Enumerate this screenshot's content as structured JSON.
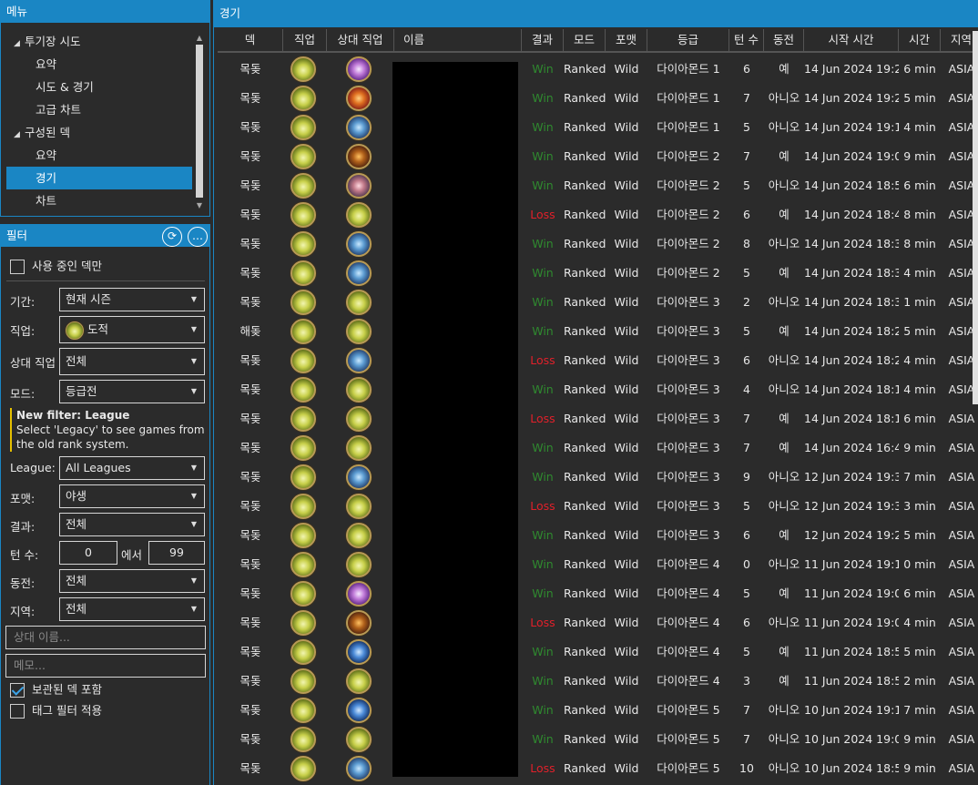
{
  "menu": {
    "title": "메뉴",
    "tree": [
      {
        "label": "투기장 시도",
        "level": 0,
        "expanded": true
      },
      {
        "label": "요약",
        "level": 1
      },
      {
        "label": "시도 & 경기",
        "level": 1
      },
      {
        "label": "고급 차트",
        "level": 1
      },
      {
        "label": "구성된 덱",
        "level": 0,
        "expanded": true
      },
      {
        "label": "요약",
        "level": 1
      },
      {
        "label": "경기",
        "level": 1,
        "selected": true
      },
      {
        "label": "차트",
        "level": 1
      }
    ]
  },
  "filter": {
    "title": "필터",
    "refresh_glyph": "⟳",
    "more_glyph": "…",
    "active_decks_only": {
      "label": "사용 중인 덱만",
      "checked": false
    },
    "period": {
      "label": "기간:",
      "value": "현재 시즌"
    },
    "class": {
      "label": "직업:",
      "value": "도적"
    },
    "opponent_class": {
      "label": "상대 직업",
      "value": "전체"
    },
    "mode": {
      "label": "모드:",
      "value": "등급전"
    },
    "notice": {
      "title": "New filter: League",
      "text": "Select 'Legacy' to see games from the old rank system."
    },
    "league": {
      "label": "League:",
      "value": "All Leagues"
    },
    "format": {
      "label": "포맷:",
      "value": "야생"
    },
    "result": {
      "label": "결과:",
      "value": "전체"
    },
    "turns": {
      "label": "턴 수:",
      "from": "0",
      "sep": "에서",
      "to": "99"
    },
    "coin": {
      "label": "동전:",
      "value": "전체"
    },
    "region": {
      "label": "지역:",
      "value": "전체"
    },
    "opponent_name": {
      "placeholder": "상대 이름..."
    },
    "note": {
      "placeholder": "메모..."
    },
    "include_archived": {
      "label": "보관된 덱 포함",
      "checked": true
    },
    "apply_tag_filter": {
      "label": "태그 필터 적용",
      "checked": false
    }
  },
  "games": {
    "title": "경기",
    "columns": [
      "덱",
      "직업",
      "상대 직업",
      "이름",
      "결과",
      "모드",
      "포맷",
      "등급",
      "턴 수",
      "동전",
      "시작 시간",
      "시간",
      "지역"
    ],
    "rows": [
      {
        "deck": "목돚",
        "class": "rogue",
        "opp": "priest",
        "result": "Win",
        "mode": "Ranked",
        "format": "Wild",
        "rank": "다이아몬드 1",
        "turns": "6",
        "coin": "예",
        "start": "14 Jun 2024 19:26",
        "duration": "6 min",
        "region": "ASIA"
      },
      {
        "deck": "목돚",
        "class": "rogue",
        "opp": "mage",
        "result": "Win",
        "mode": "Ranked",
        "format": "Wild",
        "rank": "다이아몬드 1",
        "turns": "7",
        "coin": "아니오",
        "start": "14 Jun 2024 19:20",
        "duration": "5 min",
        "region": "ASIA"
      },
      {
        "deck": "목돚",
        "class": "rogue",
        "opp": "warrior",
        "result": "Win",
        "mode": "Ranked",
        "format": "Wild",
        "rank": "다이아몬드 1",
        "turns": "5",
        "coin": "아니오",
        "start": "14 Jun 2024 19:13",
        "duration": "4 min",
        "region": "ASIA"
      },
      {
        "deck": "목돚",
        "class": "rogue",
        "opp": "druid",
        "result": "Win",
        "mode": "Ranked",
        "format": "Wild",
        "rank": "다이아몬드 2",
        "turns": "7",
        "coin": "예",
        "start": "14 Jun 2024 19:03",
        "duration": "9 min",
        "region": "ASIA"
      },
      {
        "deck": "목돚",
        "class": "rogue",
        "opp": "paladin",
        "result": "Win",
        "mode": "Ranked",
        "format": "Wild",
        "rank": "다이아몬드 2",
        "turns": "5",
        "coin": "아니오",
        "start": "14 Jun 2024 18:57",
        "duration": "6 min",
        "region": "ASIA"
      },
      {
        "deck": "목돚",
        "class": "rogue",
        "opp": "rogue",
        "result": "Loss",
        "mode": "Ranked",
        "format": "Wild",
        "rank": "다이아몬드 2",
        "turns": "6",
        "coin": "예",
        "start": "14 Jun 2024 18:47",
        "duration": "8 min",
        "region": "ASIA"
      },
      {
        "deck": "목돚",
        "class": "rogue",
        "opp": "warrior",
        "result": "Win",
        "mode": "Ranked",
        "format": "Wild",
        "rank": "다이아몬드 2",
        "turns": "8",
        "coin": "아니오",
        "start": "14 Jun 2024 18:39",
        "duration": "8 min",
        "region": "ASIA"
      },
      {
        "deck": "목돚",
        "class": "rogue",
        "opp": "warrior",
        "result": "Win",
        "mode": "Ranked",
        "format": "Wild",
        "rank": "다이아몬드 2",
        "turns": "5",
        "coin": "예",
        "start": "14 Jun 2024 18:34",
        "duration": "4 min",
        "region": "ASIA"
      },
      {
        "deck": "목돚",
        "class": "rogue",
        "opp": "rogue",
        "result": "Win",
        "mode": "Ranked",
        "format": "Wild",
        "rank": "다이아몬드 3",
        "turns": "2",
        "coin": "아니오",
        "start": "14 Jun 2024 18:32",
        "duration": "1 min",
        "region": "ASIA"
      },
      {
        "deck": "해돚",
        "class": "rogue",
        "opp": "rogue",
        "result": "Win",
        "mode": "Ranked",
        "format": "Wild",
        "rank": "다이아몬드 3",
        "turns": "5",
        "coin": "예",
        "start": "14 Jun 2024 18:27",
        "duration": "5 min",
        "region": "ASIA"
      },
      {
        "deck": "목돚",
        "class": "rogue",
        "opp": "warrior",
        "result": "Loss",
        "mode": "Ranked",
        "format": "Wild",
        "rank": "다이아몬드 3",
        "turns": "6",
        "coin": "아니오",
        "start": "14 Jun 2024 18:22",
        "duration": "4 min",
        "region": "ASIA"
      },
      {
        "deck": "목돚",
        "class": "rogue",
        "opp": "rogue",
        "result": "Win",
        "mode": "Ranked",
        "format": "Wild",
        "rank": "다이아몬드 3",
        "turns": "4",
        "coin": "아니오",
        "start": "14 Jun 2024 18:17",
        "duration": "4 min",
        "region": "ASIA"
      },
      {
        "deck": "목돚",
        "class": "rogue",
        "opp": "rogue",
        "result": "Loss",
        "mode": "Ranked",
        "format": "Wild",
        "rank": "다이아몬드 3",
        "turns": "7",
        "coin": "예",
        "start": "14 Jun 2024 18:11",
        "duration": "6 min",
        "region": "ASIA"
      },
      {
        "deck": "목돚",
        "class": "rogue",
        "opp": "rogue",
        "result": "Win",
        "mode": "Ranked",
        "format": "Wild",
        "rank": "다이아몬드 3",
        "turns": "7",
        "coin": "예",
        "start": "14 Jun 2024 16:47",
        "duration": "9 min",
        "region": "ASIA"
      },
      {
        "deck": "목돚",
        "class": "rogue",
        "opp": "warrior",
        "result": "Win",
        "mode": "Ranked",
        "format": "Wild",
        "rank": "다이아몬드 3",
        "turns": "9",
        "coin": "아니오",
        "start": "12 Jun 2024 19:35",
        "duration": "7 min",
        "region": "ASIA"
      },
      {
        "deck": "목돚",
        "class": "rogue",
        "opp": "rogue",
        "result": "Loss",
        "mode": "Ranked",
        "format": "Wild",
        "rank": "다이아몬드 3",
        "turns": "5",
        "coin": "아니오",
        "start": "12 Jun 2024 19:31",
        "duration": "3 min",
        "region": "ASIA"
      },
      {
        "deck": "목돚",
        "class": "rogue",
        "opp": "rogue",
        "result": "Win",
        "mode": "Ranked",
        "format": "Wild",
        "rank": "다이아몬드 3",
        "turns": "6",
        "coin": "예",
        "start": "12 Jun 2024 19:26",
        "duration": "5 min",
        "region": "ASIA"
      },
      {
        "deck": "목돚",
        "class": "rogue",
        "opp": "rogue",
        "result": "Win",
        "mode": "Ranked",
        "format": "Wild",
        "rank": "다이아몬드 4",
        "turns": "0",
        "coin": "아니오",
        "start": "11 Jun 2024 19:15",
        "duration": "0 min",
        "region": "ASIA"
      },
      {
        "deck": "목돚",
        "class": "rogue",
        "opp": "priest",
        "result": "Win",
        "mode": "Ranked",
        "format": "Wild",
        "rank": "다이아몬드 4",
        "turns": "5",
        "coin": "예",
        "start": "11 Jun 2024 19:09",
        "duration": "6 min",
        "region": "ASIA"
      },
      {
        "deck": "목돚",
        "class": "rogue",
        "opp": "druid",
        "result": "Loss",
        "mode": "Ranked",
        "format": "Wild",
        "rank": "다이아몬드 4",
        "turns": "6",
        "coin": "아니오",
        "start": "11 Jun 2024 19:04",
        "duration": "4 min",
        "region": "ASIA"
      },
      {
        "deck": "목돚",
        "class": "rogue",
        "opp": "shaman",
        "result": "Win",
        "mode": "Ranked",
        "format": "Wild",
        "rank": "다이아몬드 4",
        "turns": "5",
        "coin": "예",
        "start": "11 Jun 2024 18:58",
        "duration": "5 min",
        "region": "ASIA"
      },
      {
        "deck": "목돚",
        "class": "rogue",
        "opp": "rogue",
        "result": "Win",
        "mode": "Ranked",
        "format": "Wild",
        "rank": "다이아몬드 4",
        "turns": "3",
        "coin": "예",
        "start": "11 Jun 2024 18:55",
        "duration": "2 min",
        "region": "ASIA"
      },
      {
        "deck": "목돚",
        "class": "rogue",
        "opp": "shaman",
        "result": "Win",
        "mode": "Ranked",
        "format": "Wild",
        "rank": "다이아몬드 5",
        "turns": "7",
        "coin": "아니오",
        "start": "10 Jun 2024 19:16",
        "duration": "7 min",
        "region": "ASIA"
      },
      {
        "deck": "목돚",
        "class": "rogue",
        "opp": "rogue",
        "result": "Win",
        "mode": "Ranked",
        "format": "Wild",
        "rank": "다이아몬드 5",
        "turns": "7",
        "coin": "아니오",
        "start": "10 Jun 2024 19:07",
        "duration": "9 min",
        "region": "ASIA"
      },
      {
        "deck": "목돚",
        "class": "rogue",
        "opp": "warrior",
        "result": "Loss",
        "mode": "Ranked",
        "format": "Wild",
        "rank": "다이아몬드 5",
        "turns": "10",
        "coin": "아니오",
        "start": "10 Jun 2024 18:57",
        "duration": "9 min",
        "region": "ASIA"
      }
    ]
  }
}
